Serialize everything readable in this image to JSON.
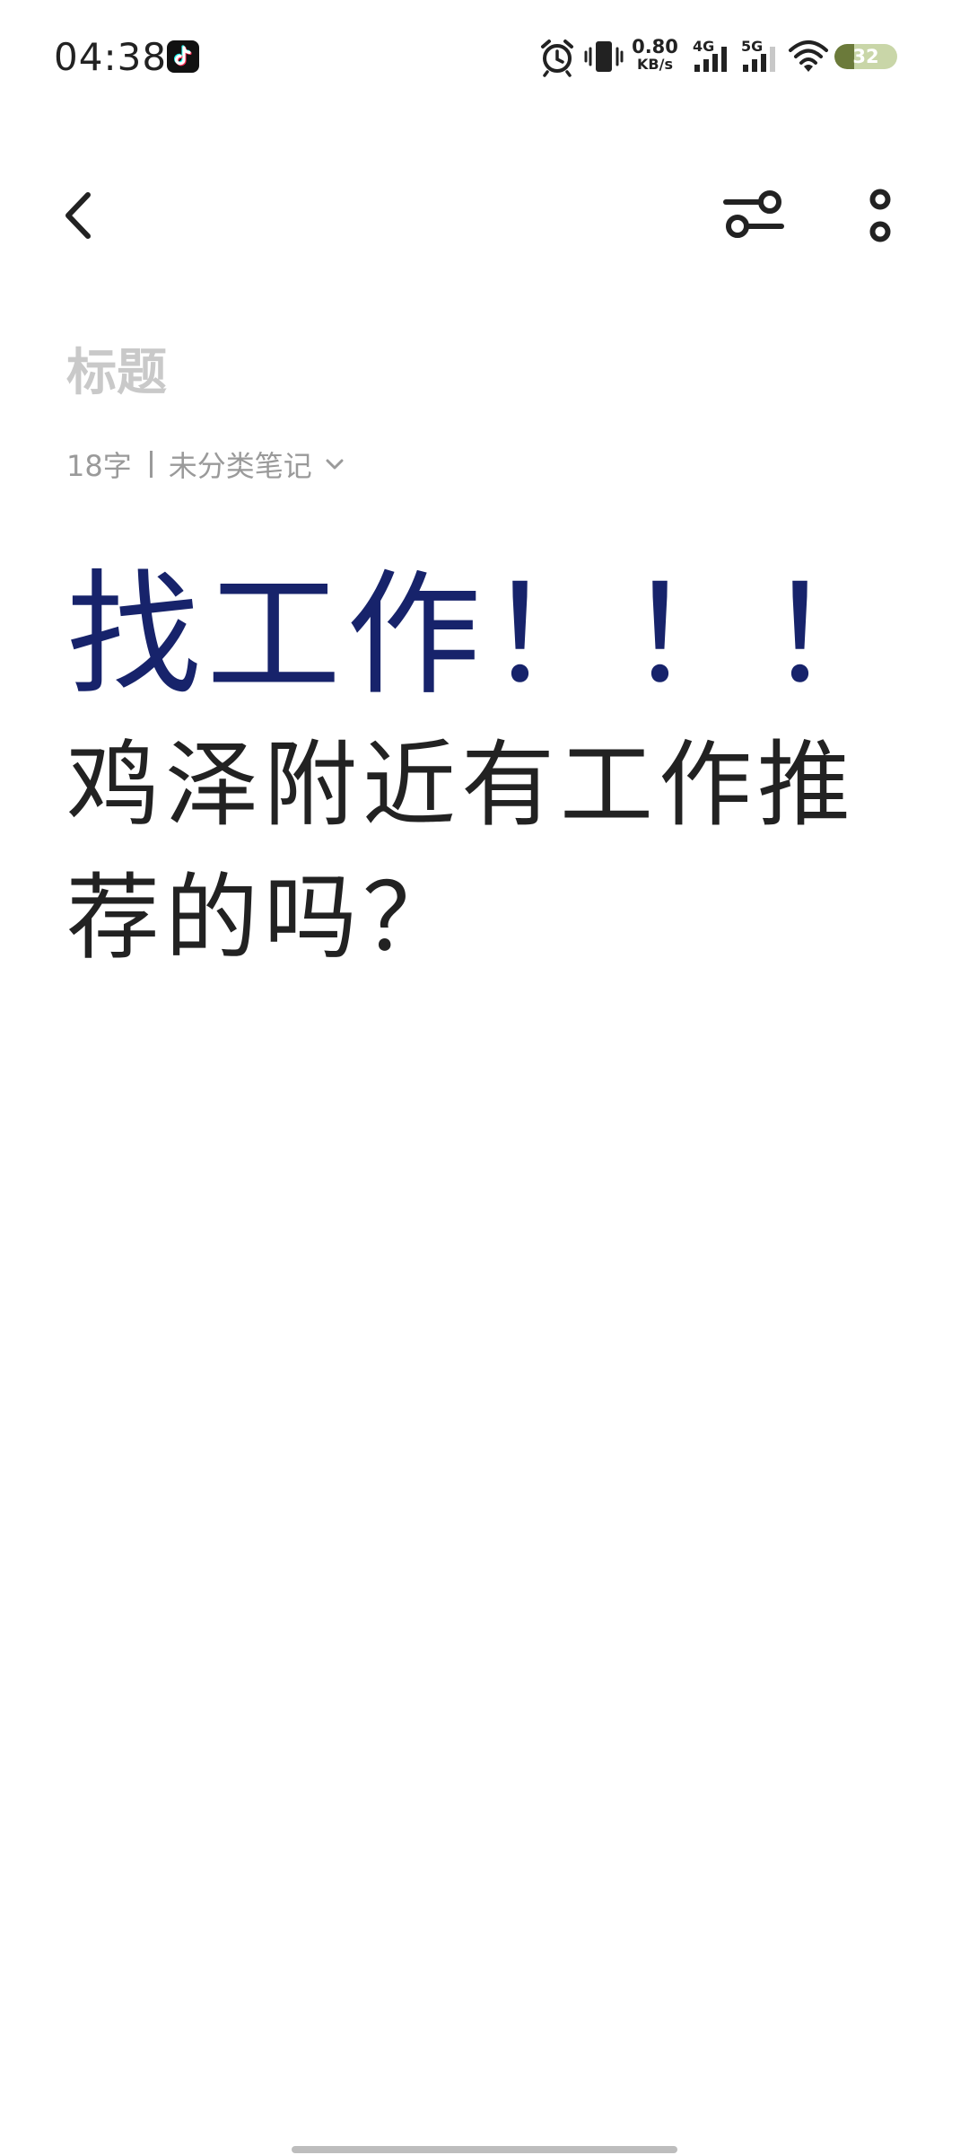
{
  "status_bar": {
    "time": "04:38",
    "net_speed_value": "0.80",
    "net_speed_unit": "KB/s",
    "net_1": "4G",
    "net_2": "5G",
    "battery_level": "32",
    "battery_fraction": 0.32
  },
  "toolbar": {
    "back_icon": "chevron-left-icon",
    "style_icon": "style-toggle-icon",
    "more_icon": "more-vertical-icon"
  },
  "note": {
    "title_placeholder": "标题",
    "word_count": "18字",
    "folder": "未分类笔记",
    "heading": "找工作！！！",
    "body": "鸡泽附近有工作推荐的吗？"
  },
  "colors": {
    "heading": "#17236b",
    "body": "#222222",
    "placeholder": "#c9c9c9",
    "meta": "#9a9a9a"
  }
}
